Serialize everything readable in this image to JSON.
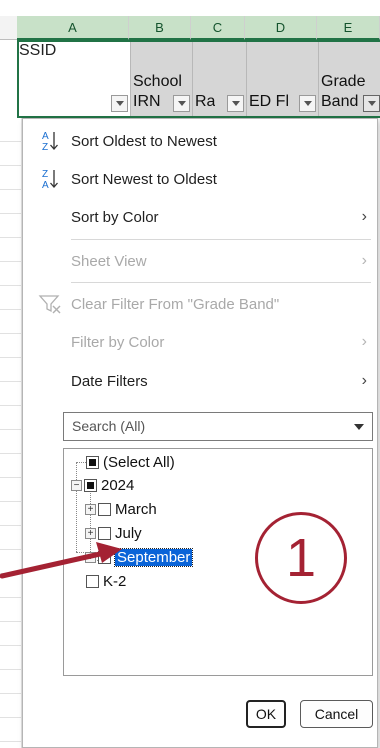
{
  "columns": [
    {
      "letter": "A",
      "header": "SSID"
    },
    {
      "letter": "B",
      "header_line1": "School",
      "header_line2": "IRN"
    },
    {
      "letter": "C",
      "header": "Ra"
    },
    {
      "letter": "D",
      "header": "ED Fl"
    },
    {
      "letter": "E",
      "header_line1": "Grade",
      "header_line2": "Band"
    }
  ],
  "menu": {
    "sort_asc": "Sort Oldest to Newest",
    "sort_desc": "Sort Newest to Oldest",
    "sort_color": "Sort by Color",
    "sheet_view": "Sheet View",
    "clear_filter": "Clear Filter From \"Grade Band\"",
    "filter_color": "Filter by Color",
    "date_filters": "Date Filters"
  },
  "search": {
    "placeholder": "Search (All)"
  },
  "tree": {
    "select_all": "(Select All)",
    "year": "2024",
    "months": [
      "March",
      "July",
      "September"
    ],
    "other": "K-2"
  },
  "buttons": {
    "ok": "OK",
    "cancel": "Cancel"
  },
  "annotation": {
    "callout_number": "1",
    "color": "#a42233"
  },
  "colors": {
    "excel_green": "#217346",
    "selection_blue": "#0a64d8"
  }
}
